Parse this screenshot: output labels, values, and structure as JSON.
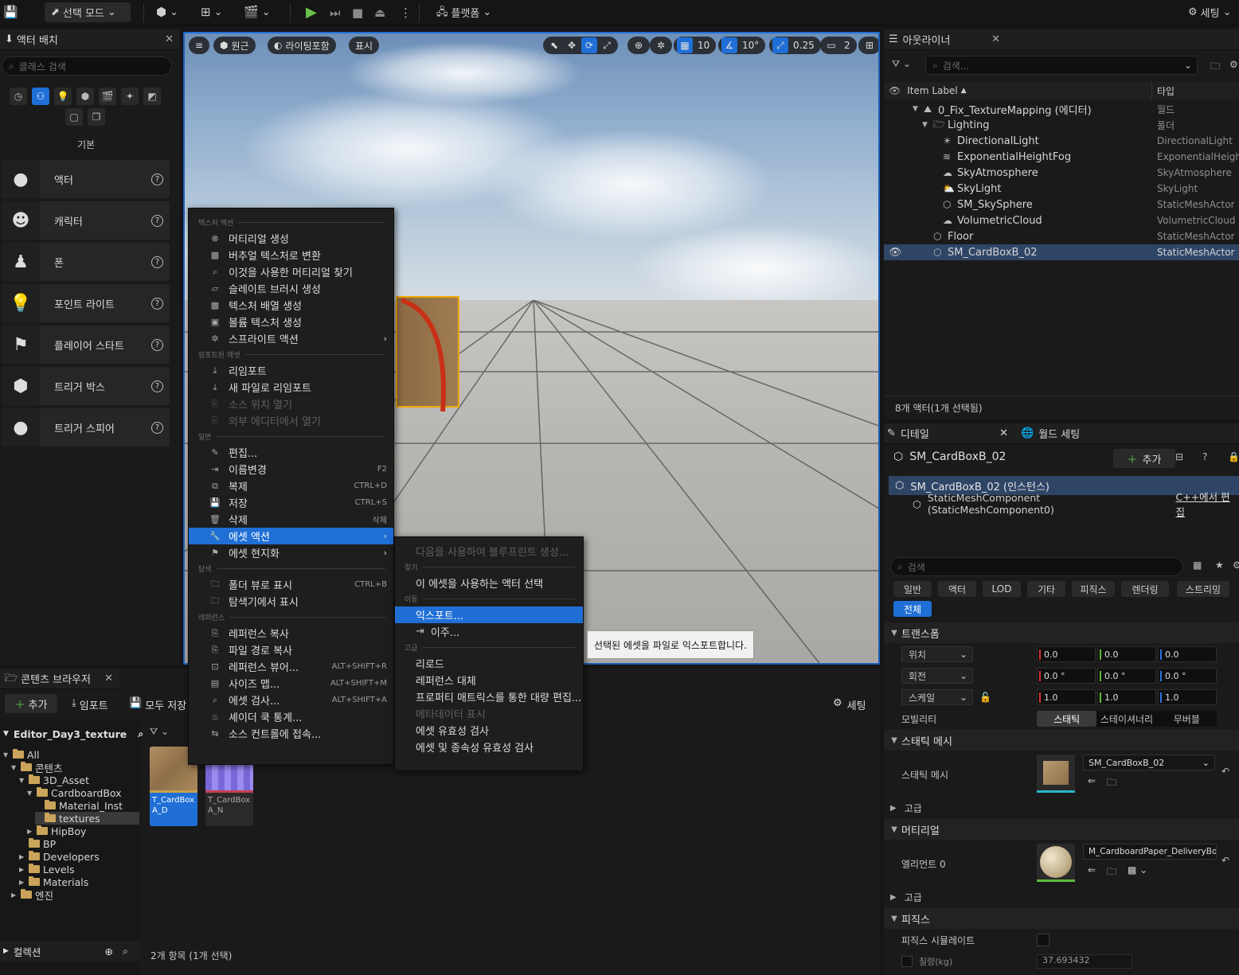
{
  "toolbar": {
    "mode_label": "선택 모드",
    "platform_label": "플랫폼",
    "settings_label": "세팅"
  },
  "place_actors": {
    "tab_title": "액터 배치",
    "search_placeholder": "클래스 검색",
    "category_label": "기본",
    "items": [
      {
        "label": "액터",
        "icon": "sphere-icon"
      },
      {
        "label": "캐릭터",
        "icon": "character-icon"
      },
      {
        "label": "폰",
        "icon": "pawn-icon"
      },
      {
        "label": "포인트 라이트",
        "icon": "bulb-icon"
      },
      {
        "label": "플레이어 스타트",
        "icon": "flag-icon"
      },
      {
        "label": "트리거 박스",
        "icon": "cube-icon"
      },
      {
        "label": "트리거 스피어",
        "icon": "sphere-icon"
      }
    ]
  },
  "viewport": {
    "perspective_label": "원근",
    "lit_label": "라이팅포함",
    "show_label": "표시",
    "grid_snap": "10",
    "rotation_snap": "10°",
    "scale_snap": "0.25",
    "camera_speed": "2"
  },
  "context_menu": {
    "sections": [
      {
        "title": "텍스처 액션",
        "items": [
          {
            "label": "머티리얼 생성",
            "shortcut": "",
            "sub": false,
            "disabled": false
          },
          {
            "label": "버추얼 텍스처로 변환",
            "shortcut": "",
            "sub": false,
            "disabled": false
          },
          {
            "label": "이것을 사용한 머티리얼 찾기",
            "shortcut": "",
            "sub": false,
            "disabled": false
          },
          {
            "label": "슬레이트 브러시 생성",
            "shortcut": "",
            "sub": false,
            "disabled": false
          },
          {
            "label": "텍스처 배열 생성",
            "shortcut": "",
            "sub": false,
            "disabled": false
          },
          {
            "label": "볼륨 텍스처 생성",
            "shortcut": "",
            "sub": false,
            "disabled": false
          },
          {
            "label": "스프라이트 액션",
            "shortcut": "",
            "sub": true,
            "disabled": false
          }
        ]
      },
      {
        "title": "임포트된 에셋",
        "items": [
          {
            "label": "리임포트",
            "shortcut": "",
            "sub": false,
            "disabled": false
          },
          {
            "label": "새 파일로 리임포트",
            "shortcut": "",
            "sub": false,
            "disabled": false
          },
          {
            "label": "소스 위치 열기",
            "shortcut": "",
            "sub": false,
            "disabled": true
          },
          {
            "label": "외부 에디터에서 열기",
            "shortcut": "",
            "sub": false,
            "disabled": true
          }
        ]
      },
      {
        "title": "일반",
        "items": [
          {
            "label": "편집...",
            "shortcut": "",
            "sub": false,
            "disabled": false
          },
          {
            "label": "이름변경",
            "shortcut": "F2",
            "sub": false,
            "disabled": false
          },
          {
            "label": "복제",
            "shortcut": "CTRL+D",
            "sub": false,
            "disabled": false
          },
          {
            "label": "저장",
            "shortcut": "CTRL+S",
            "sub": false,
            "disabled": false
          },
          {
            "label": "삭제",
            "shortcut": "삭제",
            "sub": false,
            "disabled": false
          },
          {
            "label": "에셋 액션",
            "shortcut": "",
            "sub": true,
            "disabled": false,
            "highlighted": true
          },
          {
            "label": "에셋 현지화",
            "shortcut": "",
            "sub": true,
            "disabled": false
          }
        ]
      },
      {
        "title": "탐색",
        "items": [
          {
            "label": "폴더 뷰로 표시",
            "shortcut": "CTRL+B",
            "sub": false,
            "disabled": false
          },
          {
            "label": "탐색기에서 표시",
            "shortcut": "",
            "sub": false,
            "disabled": false
          }
        ]
      },
      {
        "title": "레퍼런스",
        "items": [
          {
            "label": "레퍼런스 복사",
            "shortcut": "",
            "sub": false,
            "disabled": false
          },
          {
            "label": "파일 경로 복사",
            "shortcut": "",
            "sub": false,
            "disabled": false
          },
          {
            "label": "레퍼런스 뷰어...",
            "shortcut": "ALT+SHIFT+R",
            "sub": false,
            "disabled": false
          },
          {
            "label": "사이즈 맵...",
            "shortcut": "ALT+SHIFT+M",
            "sub": false,
            "disabled": false
          },
          {
            "label": "에셋 검사...",
            "shortcut": "ALT+SHIFT+A",
            "sub": false,
            "disabled": false
          },
          {
            "label": "셰이더 쿡 통계...",
            "shortcut": "",
            "sub": false,
            "disabled": false
          },
          {
            "label": "소스 컨트롤에 접속...",
            "shortcut": "",
            "sub": false,
            "disabled": false
          }
        ]
      }
    ]
  },
  "submenu": {
    "items": [
      {
        "type": "item",
        "label": "다음을 사용하여 블루프린트 생성...",
        "disabled": true
      },
      {
        "type": "section",
        "label": "찾기"
      },
      {
        "type": "item",
        "label": "이 에셋을 사용하는 액터 선택"
      },
      {
        "type": "section",
        "label": "이동"
      },
      {
        "type": "item",
        "label": "익스포트...",
        "highlighted": true
      },
      {
        "type": "item",
        "label": "이주...",
        "icon": true
      },
      {
        "type": "section",
        "label": "고급"
      },
      {
        "type": "item",
        "label": "리로드"
      },
      {
        "type": "item",
        "label": "레퍼런스 대체"
      },
      {
        "type": "item",
        "label": "프로퍼티 매트릭스를 통한 대량 편집..."
      },
      {
        "type": "item",
        "label": "메타데이터 표시",
        "disabled": true
      },
      {
        "type": "item",
        "label": "에셋 유효성 검사"
      },
      {
        "type": "item",
        "label": "에셋 및 종속성 유효성 검사"
      }
    ]
  },
  "tooltip": "선택된 에셋을 파일로 익스포트합니다.",
  "outliner": {
    "tab_title": "아웃라이너",
    "search_placeholder": "검색...",
    "col_label": "Item Label",
    "col_type": "타입",
    "rows": [
      {
        "label": "0_Fix_TextureMapping (에디터)",
        "type": "월드",
        "indent": 0
      },
      {
        "label": "Lighting",
        "type": "폴더",
        "indent": 1
      },
      {
        "label": "DirectionalLight",
        "type": "DirectionalLight",
        "indent": 2
      },
      {
        "label": "ExponentialHeightFog",
        "type": "ExponentialHeight",
        "indent": 2
      },
      {
        "label": "SkyAtmosphere",
        "type": "SkyAtmosphere",
        "indent": 2
      },
      {
        "label": "SkyLight",
        "type": "SkyLight",
        "indent": 2
      },
      {
        "label": "SM_SkySphere",
        "type": "StaticMeshActor",
        "indent": 2
      },
      {
        "label": "VolumetricCloud",
        "type": "VolumetricCloud",
        "indent": 2
      },
      {
        "label": "Floor",
        "type": "StaticMeshActor",
        "indent": 1
      },
      {
        "label": "SM_CardBoxB_02",
        "type": "StaticMeshActor",
        "indent": 1,
        "selected": true
      }
    ],
    "status": "8개 액터(1개 선택됨)"
  },
  "details": {
    "tab_title": "디테일",
    "tab2_title": "월드 세팅",
    "actor_name": "SM_CardBoxB_02",
    "add_label": "추가",
    "instance_label": "SM_CardBoxB_02 (인스턴스)",
    "component_label": "StaticMeshComponent (StaticMeshComponent0)",
    "cpp_link": "C++에서 편집",
    "search_placeholder": "검색",
    "filters": [
      "일반",
      "액터",
      "LOD",
      "기타",
      "피직스",
      "렌더링",
      "스트리밍"
    ],
    "filter_all": "전체",
    "transform_title": "트랜스폼",
    "location_label": "위치",
    "location": [
      "0.0",
      "0.0",
      "0.0"
    ],
    "rotation_label": "회전",
    "rotation": [
      "0.0 °",
      "0.0 °",
      "0.0 °"
    ],
    "scale_label": "스케일",
    "scale": [
      "1.0",
      "1.0",
      "1.0"
    ],
    "mobility_label": "모빌리티",
    "mobility_options": [
      "스태틱",
      "스테이셔너리",
      "무버블"
    ],
    "static_mesh_title": "스태틱 메시",
    "static_mesh_label": "스태틱 메시",
    "static_mesh_value": "SM_CardBoxB_02",
    "advanced_label": "고급",
    "material_title": "머티리얼",
    "element_label": "엘리먼트 0",
    "material_value": "M_CardboardPaper_DeliveryBox",
    "advanced2_label": "고급",
    "physics_title": "피직스",
    "simulate_label": "피직스 시뮬레이트",
    "mass_label": "질량(kg)",
    "mass_value": "37.693432"
  },
  "content_browser": {
    "tab_title": "콘텐츠 브라우저",
    "add_label": "추가",
    "import_label": "임포트",
    "save_all_label": "모두 저장",
    "settings_label": "세팅",
    "root_label": "Editor_Day3_texture",
    "tree": [
      {
        "label": "All",
        "indent": 0
      },
      {
        "label": "콘텐츠",
        "indent": 1
      },
      {
        "label": "3D_Asset",
        "indent": 2
      },
      {
        "label": "CardboardBox",
        "indent": 3
      },
      {
        "label": "Material_Inst",
        "indent": 4
      },
      {
        "label": "textures",
        "indent": 4,
        "selected": true
      },
      {
        "label": "HipBoy",
        "indent": 3
      },
      {
        "label": "BP",
        "indent": 2
      },
      {
        "label": "Developers",
        "indent": 2
      },
      {
        "label": "Levels",
        "indent": 2
      },
      {
        "label": "Materials",
        "indent": 2
      },
      {
        "label": "엔진",
        "indent": 1
      }
    ],
    "collections_label": "컬렉션",
    "assets": [
      {
        "name": "T_CardBox A_D",
        "selected": true
      },
      {
        "name": "T_CardBox A_N",
        "selected": false
      }
    ],
    "status": "2개 항목 (1개 선택)"
  }
}
